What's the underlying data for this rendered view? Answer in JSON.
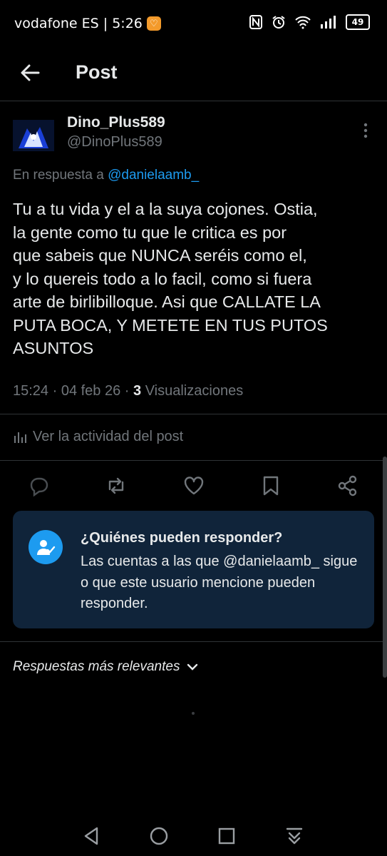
{
  "status_bar": {
    "carrier_time": "vodafone ES | 5:26",
    "battery": "49",
    "icons": [
      "nfc-icon",
      "alarm-icon",
      "wifi-icon",
      "signal-icon",
      "battery-icon"
    ]
  },
  "header": {
    "title": "Post",
    "back_icon": "arrow-left-icon"
  },
  "post": {
    "display_name": "Dino_Plus589",
    "handle": "@DinoPlus589",
    "reply_prefix": "En respuesta a",
    "reply_to": "@danielaamb_",
    "text": "Tu a tu vida y el a la suya cojones. Ostia,\nla gente como tu que le critica es por\nque sabeis que NUNCA seréis como el,\ny lo quereis todo a lo facil, como si fuera\narte de birlibilloque. Asi que CALLATE LA\nPUTA BOCA, Y METETE EN TUS PUTOS\nASUNTOS",
    "timestamp": "15:24 · 04 feb 26 · ",
    "views_count": "3",
    "views_label": " Visualizaciones",
    "activity_label": "Ver la actividad del post",
    "actions": [
      "reply-icon",
      "repost-icon",
      "like-icon",
      "bookmark-icon",
      "share-icon"
    ]
  },
  "reply_card": {
    "title": "¿Quiénes pueden responder?",
    "body": "Las cuentas a las que @danielaamb_ sigue o que este usuario mencione pueden responder."
  },
  "replies_sort": {
    "label": "Respuestas más relevantes"
  },
  "colors": {
    "accent": "#1d9bf0",
    "card_bg": "#10243a",
    "muted": "#71767b",
    "background": "#000000"
  }
}
